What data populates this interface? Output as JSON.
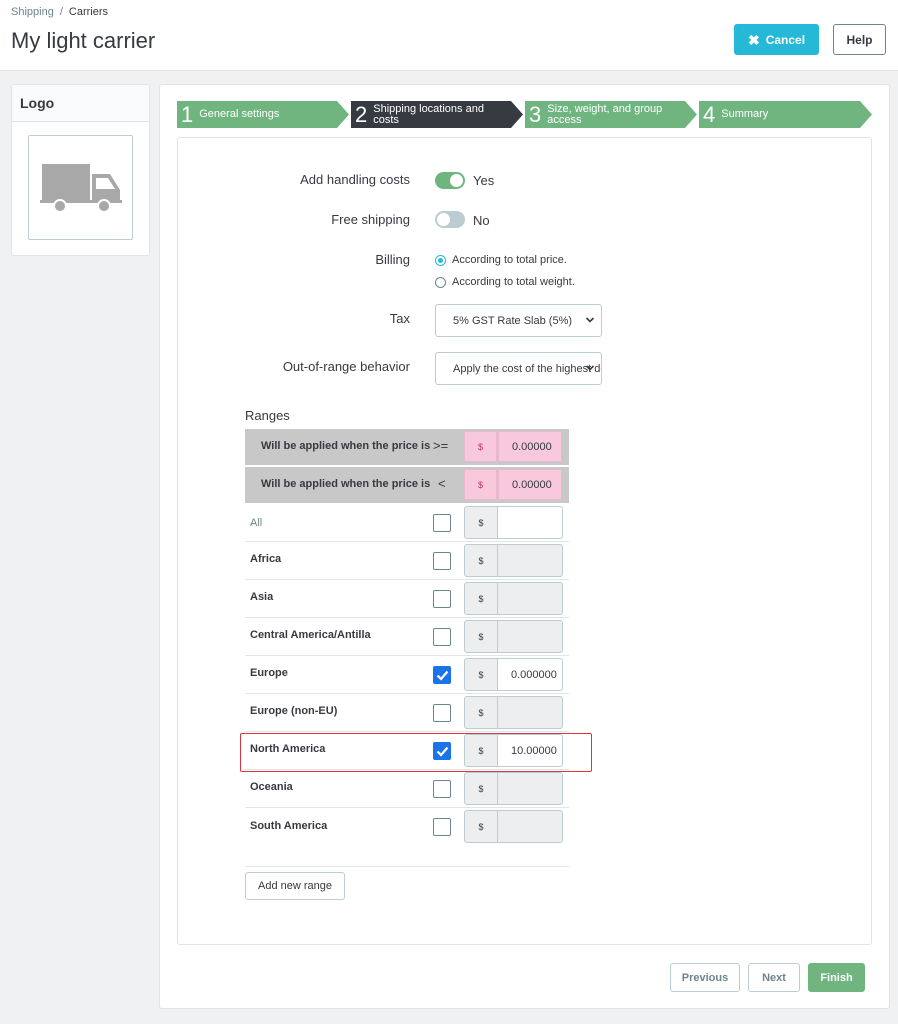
{
  "breadcrumb": {
    "parent": "Shipping",
    "separator": "/",
    "current": "Carriers"
  },
  "header": {
    "title": "My light carrier",
    "cancel_label": "Cancel",
    "help_label": "Help"
  },
  "logo": {
    "heading": "Logo"
  },
  "steps": [
    {
      "number": "1",
      "label": "General settings",
      "state": "done",
      "color": "#70b580"
    },
    {
      "number": "2",
      "label": "Shipping locations and costs",
      "state": "active",
      "color": "#363a41"
    },
    {
      "number": "3",
      "label": "Size, weight, and group access",
      "state": "todo",
      "color": "#70b580"
    },
    {
      "number": "4",
      "label": "Summary",
      "state": "todo",
      "color": "#70b580"
    }
  ],
  "form": {
    "handling": {
      "label": "Add handling costs",
      "value": "Yes",
      "on": true
    },
    "free_shipping": {
      "label": "Free shipping",
      "value": "No",
      "on": false
    },
    "billing": {
      "label": "Billing",
      "options": [
        "According to total price.",
        "According to total weight."
      ],
      "selected": "According to total price."
    },
    "tax": {
      "label": "Tax",
      "value": "5% GST Rate Slab (5%)"
    },
    "out_of_range": {
      "label": "Out-of-range behavior",
      "value": "Apply the cost of the highest defined range"
    }
  },
  "ranges": {
    "title": "Ranges",
    "headers": [
      {
        "text": "Will be applied when the price is",
        "operator": ">=",
        "currency": "$",
        "value": "0.00000"
      },
      {
        "text": "Will be applied when the price is",
        "operator": "<",
        "currency": "$",
        "value": "0.00000"
      }
    ],
    "zones": [
      {
        "name": "All",
        "checked": false,
        "currency": "$",
        "value": ""
      },
      {
        "name": "Africa",
        "checked": false,
        "currency": "$",
        "value": ""
      },
      {
        "name": "Asia",
        "checked": false,
        "currency": "$",
        "value": ""
      },
      {
        "name": "Central America/Antilla",
        "checked": false,
        "currency": "$",
        "value": ""
      },
      {
        "name": "Europe",
        "checked": true,
        "currency": "$",
        "value": "0.000000"
      },
      {
        "name": "Europe (non-EU)",
        "checked": false,
        "currency": "$",
        "value": ""
      },
      {
        "name": "North America",
        "checked": true,
        "currency": "$",
        "value": "10.00000"
      },
      {
        "name": "Oceania",
        "checked": false,
        "currency": "$",
        "value": ""
      },
      {
        "name": "South America",
        "checked": false,
        "currency": "$",
        "value": ""
      }
    ],
    "add_label": "Add new range"
  },
  "footer": {
    "previous_label": "Previous",
    "next_label": "Next",
    "finish_label": "Finish"
  },
  "colors": {
    "accent": "#25b9d7",
    "success": "#70b580",
    "highlight": "#d9363e",
    "checkbox": "#1a73e8"
  }
}
